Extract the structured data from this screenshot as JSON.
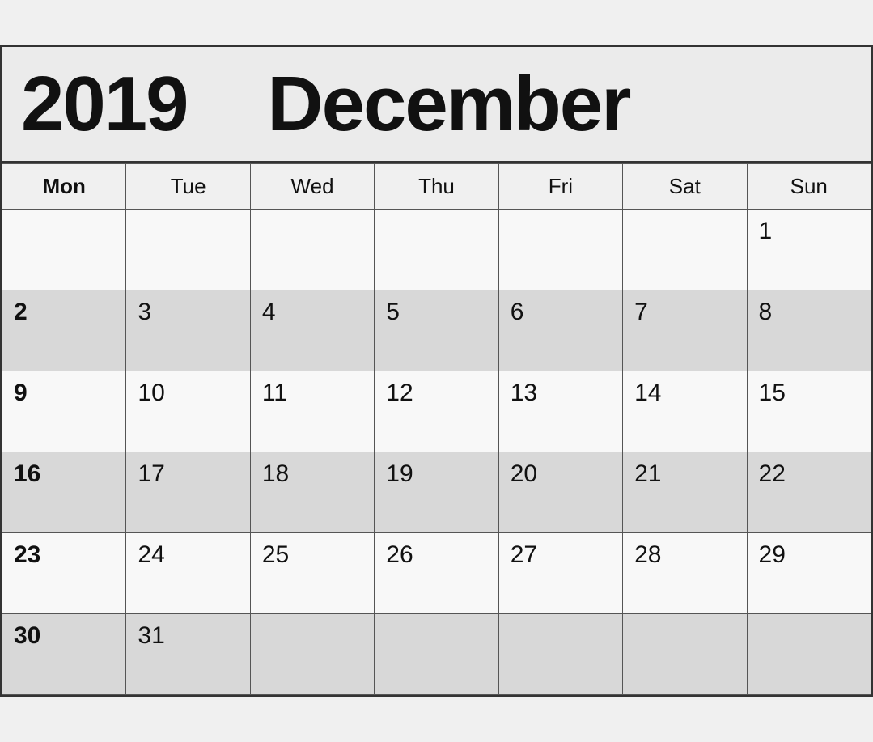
{
  "header": {
    "year": "2019",
    "month": "December"
  },
  "weekdays": [
    {
      "label": "Mon",
      "bold": true
    },
    {
      "label": "Tue",
      "bold": false
    },
    {
      "label": "Wed",
      "bold": false
    },
    {
      "label": "Thu",
      "bold": false
    },
    {
      "label": "Fri",
      "bold": false
    },
    {
      "label": "Sat",
      "bold": false
    },
    {
      "label": "Sun",
      "bold": false
    }
  ],
  "weeks": [
    {
      "shaded": false,
      "days": [
        {
          "num": "",
          "bold": false
        },
        {
          "num": "",
          "bold": false
        },
        {
          "num": "",
          "bold": false
        },
        {
          "num": "",
          "bold": false
        },
        {
          "num": "",
          "bold": false
        },
        {
          "num": "",
          "bold": false
        },
        {
          "num": "1",
          "bold": false
        }
      ]
    },
    {
      "shaded": true,
      "days": [
        {
          "num": "2",
          "bold": true
        },
        {
          "num": "3",
          "bold": false
        },
        {
          "num": "4",
          "bold": false
        },
        {
          "num": "5",
          "bold": false
        },
        {
          "num": "6",
          "bold": false
        },
        {
          "num": "7",
          "bold": false
        },
        {
          "num": "8",
          "bold": false
        }
      ]
    },
    {
      "shaded": false,
      "days": [
        {
          "num": "9",
          "bold": true
        },
        {
          "num": "10",
          "bold": false
        },
        {
          "num": "11",
          "bold": false
        },
        {
          "num": "12",
          "bold": false
        },
        {
          "num": "13",
          "bold": false
        },
        {
          "num": "14",
          "bold": false
        },
        {
          "num": "15",
          "bold": false
        }
      ]
    },
    {
      "shaded": true,
      "days": [
        {
          "num": "16",
          "bold": true
        },
        {
          "num": "17",
          "bold": false
        },
        {
          "num": "18",
          "bold": false
        },
        {
          "num": "19",
          "bold": false
        },
        {
          "num": "20",
          "bold": false
        },
        {
          "num": "21",
          "bold": false
        },
        {
          "num": "22",
          "bold": false
        }
      ]
    },
    {
      "shaded": false,
      "days": [
        {
          "num": "23",
          "bold": true
        },
        {
          "num": "24",
          "bold": false
        },
        {
          "num": "25",
          "bold": false
        },
        {
          "num": "26",
          "bold": false
        },
        {
          "num": "27",
          "bold": false
        },
        {
          "num": "28",
          "bold": false
        },
        {
          "num": "29",
          "bold": false
        }
      ]
    },
    {
      "shaded": true,
      "days": [
        {
          "num": "30",
          "bold": true
        },
        {
          "num": "31",
          "bold": false
        },
        {
          "num": "",
          "bold": false
        },
        {
          "num": "",
          "bold": false
        },
        {
          "num": "",
          "bold": false
        },
        {
          "num": "",
          "bold": false
        },
        {
          "num": "",
          "bold": false
        }
      ]
    }
  ]
}
